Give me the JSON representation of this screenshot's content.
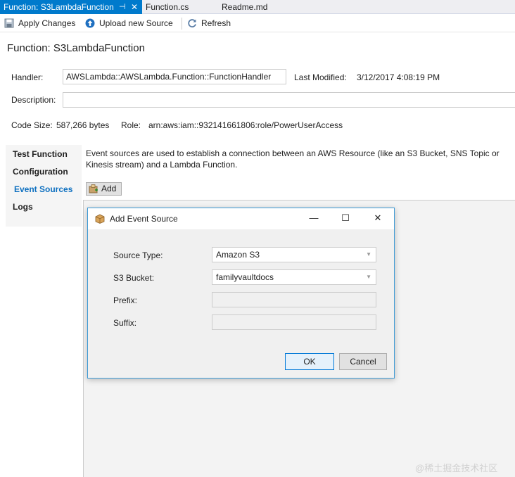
{
  "tabs": [
    {
      "label": "Function: S3LambdaFunction",
      "active": true,
      "pin": "⊣",
      "close": "✕"
    },
    {
      "label": "Function.cs",
      "active": false
    },
    {
      "label": "Readme.md",
      "active": false
    }
  ],
  "toolbar": {
    "apply_label": "Apply Changes",
    "upload_label": "Upload new Source",
    "refresh_label": "Refresh",
    "apply_icon": "save-icon",
    "upload_icon": "upload-icon",
    "refresh_icon": "refresh-icon"
  },
  "page": {
    "title": "Function: S3LambdaFunction"
  },
  "fields": {
    "handler_label": "Handler:",
    "handler_value": "AWSLambda::AWSLambda.Function::FunctionHandler",
    "last_modified_label": "Last Modified:",
    "last_modified_value": "3/12/2017 4:08:19 PM",
    "description_label": "Description:",
    "description_value": "",
    "code_size_label": "Code Size:",
    "code_size_value": "587,266 bytes",
    "role_label": "Role:",
    "role_value": "arn:aws:iam::932141661806:role/PowerUserAccess"
  },
  "nav": {
    "items": [
      {
        "label": "Test Function",
        "selected": false
      },
      {
        "label": "Configuration",
        "selected": false
      },
      {
        "label": "Event Sources",
        "selected": true
      },
      {
        "label": "Logs",
        "selected": false
      }
    ]
  },
  "event_sources": {
    "description": "Event sources are used to establish a connection between an AWS Resource (like an S3 Bucket, SNS Topic or Kinesis stream) and a Lambda Function.",
    "add_label": "Add"
  },
  "dialog": {
    "title": "Add Event Source",
    "minimize": "—",
    "maximize": "☐",
    "close": "✕",
    "source_type_label": "Source Type:",
    "source_type_value": "Amazon S3",
    "bucket_label": "S3 Bucket:",
    "bucket_value": "familyvaultdocs",
    "prefix_label": "Prefix:",
    "prefix_value": "",
    "suffix_label": "Suffix:",
    "suffix_value": "",
    "ok_label": "OK",
    "cancel_label": "Cancel",
    "dropdown_arrow": "▼"
  },
  "watermark": "@稀土掘金技术社区",
  "colors": {
    "accent": "#007acc",
    "nav_selected": "#0e70c0",
    "dialog_border": "#3d9ad6"
  }
}
